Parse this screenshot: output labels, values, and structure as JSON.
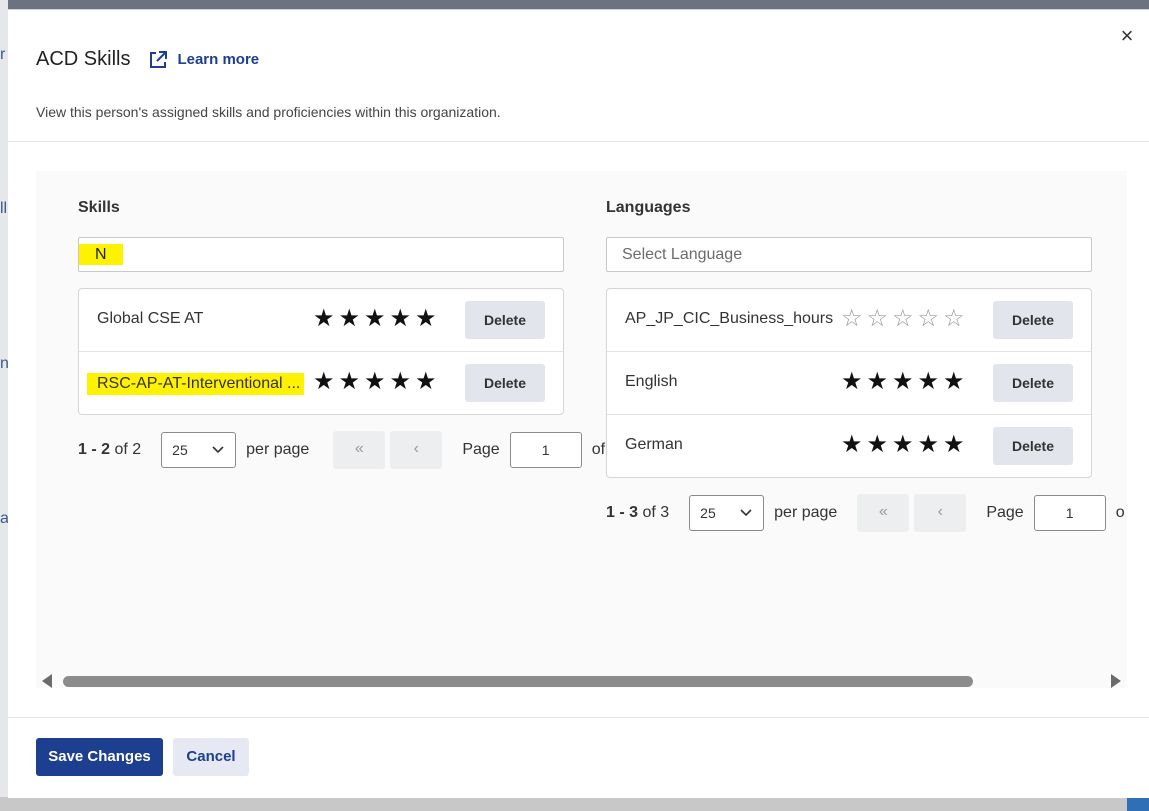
{
  "backdrop": {
    "fragments": [
      "r",
      "ll",
      "n",
      "a"
    ]
  },
  "modal": {
    "title": "ACD Skills",
    "learn_more": "Learn more",
    "subtitle": "View this person's assigned skills and proficiencies within this organization.",
    "close_label": "×"
  },
  "skills": {
    "heading": "Skills",
    "search_value": "N",
    "items": [
      {
        "label": "Global CSE AT",
        "rating": 5,
        "delete_label": "Delete"
      },
      {
        "label": "RSC-AP-AT-Interventional ...",
        "rating": 5,
        "delete_label": "Delete"
      }
    ],
    "pager": {
      "range": "1 - 2",
      "of_text": "of 2",
      "per_page_value": "25",
      "per_page_label": "per page",
      "first_label": "«",
      "prev_label": "‹",
      "page_label": "Page",
      "page_value": "1",
      "of_suffix": "of"
    }
  },
  "languages": {
    "heading": "Languages",
    "placeholder": "Select Language",
    "items": [
      {
        "label": "AP_JP_CIC_Business_hours",
        "rating": 0,
        "delete_label": "Delete"
      },
      {
        "label": "English",
        "rating": 5,
        "delete_label": "Delete"
      },
      {
        "label": "German",
        "rating": 5,
        "delete_label": "Delete"
      }
    ],
    "pager": {
      "range": "1 - 3",
      "of_text": "of 3",
      "per_page_value": "25",
      "per_page_label": "per page",
      "first_label": "«",
      "prev_label": "‹",
      "page_label": "Page",
      "page_value": "1",
      "of_suffix": "o"
    }
  },
  "footer": {
    "save_label": "Save Changes",
    "cancel_label": "Cancel"
  },
  "colors": {
    "primary": "#1d3f8f",
    "highlight": "#fff200",
    "delete_bg": "#e3e5ec"
  },
  "icons": {
    "external_link": "external-link-icon",
    "close": "close-icon",
    "star_full": "star-filled-icon",
    "star_empty": "star-outline-icon",
    "chevron": "chevron-down-icon"
  }
}
